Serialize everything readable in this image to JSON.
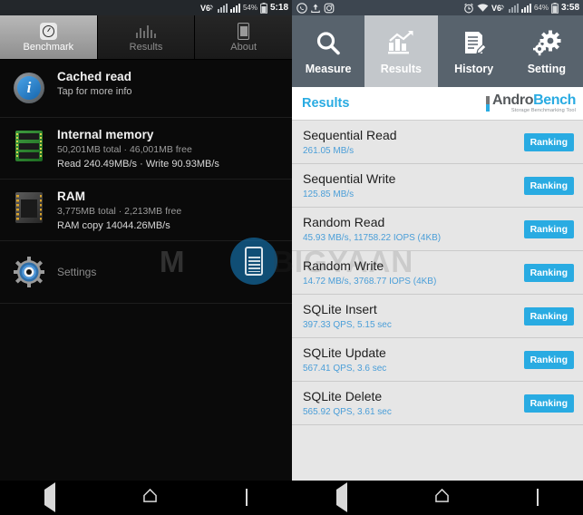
{
  "left_phone": {
    "statusbar": {
      "icons": [
        "volte-icon",
        "signal-roaming-icon",
        "sim-signal-icon",
        "signal-bars-icon"
      ],
      "battery_percent": "54%",
      "battery_icon": "battery-icon",
      "time": "5:18"
    },
    "tabs": [
      {
        "label": "Benchmark",
        "icon": "gauge-icon",
        "selected": true
      },
      {
        "label": "Results",
        "icon": "bar-chart-icon",
        "selected": false
      },
      {
        "label": "About",
        "icon": "phone-icon",
        "selected": false
      }
    ],
    "rows": [
      {
        "icon": "info-icon",
        "title": "Cached read",
        "sub": "Tap for more info",
        "sub2": ""
      },
      {
        "icon": "memory-chip-icon",
        "title": "Internal memory",
        "sub": "50,201MB total · 46,001MB free",
        "sub2": "Read 240.49MB/s · Write 90.93MB/s"
      },
      {
        "icon": "ram-chip-icon",
        "title": "RAM",
        "sub": "3,775MB total · 2,213MB free",
        "sub2": "RAM copy 14044.26MB/s"
      }
    ],
    "settings": {
      "icon": "gear-icon",
      "label": "Settings"
    }
  },
  "right_phone": {
    "statusbar": {
      "left_icons": [
        "whatsapp-icon",
        "upload-icon",
        "instagram-icon"
      ],
      "right_icons": [
        "alarm-icon",
        "wifi-icon",
        "volte-icon",
        "signal-roaming-icon",
        "sim-signal-icon",
        "signal-bars-icon"
      ],
      "battery_percent": "64%",
      "battery_icon": "battery-icon",
      "time": "3:58"
    },
    "tabs": [
      {
        "label": "Measure",
        "icon": "magnifier-icon",
        "selected": false
      },
      {
        "label": "Results",
        "icon": "chart-growth-icon",
        "selected": true
      },
      {
        "label": "History",
        "icon": "document-pen-icon",
        "selected": false
      },
      {
        "label": "Setting",
        "icon": "gears-icon",
        "selected": false
      }
    ],
    "header": {
      "title": "Results",
      "logo_main_a": "Andro",
      "logo_main_b": "Bench",
      "logo_sub": "Storage Benchmarking Tool"
    },
    "results": [
      {
        "name": "Sequential Read",
        "value": "261.05 MB/s",
        "button": "Ranking"
      },
      {
        "name": "Sequential Write",
        "value": "125.85 MB/s",
        "button": "Ranking"
      },
      {
        "name": "Random Read",
        "value": "45.93 MB/s, 11758.22 IOPS (4KB)",
        "button": "Ranking"
      },
      {
        "name": "Random Write",
        "value": "14.72 MB/s, 3768.77 IOPS (4KB)",
        "button": "Ranking"
      },
      {
        "name": "SQLite Insert",
        "value": "397.33 QPS, 5.15 sec",
        "button": "Ranking"
      },
      {
        "name": "SQLite Update",
        "value": "567.41 QPS, 3.6 sec",
        "button": "Ranking"
      },
      {
        "name": "SQLite Delete",
        "value": "565.92 QPS, 3.61 sec",
        "button": "Ranking"
      }
    ]
  },
  "watermark": {
    "text_a": "M",
    "text_b": "BIGYAAN",
    "logo": "phone-badge-icon"
  },
  "navbar": {
    "back": "back-icon",
    "home": "home-icon",
    "recents": "recents-icon"
  },
  "colors": {
    "accent_blue": "#29abe2",
    "right_header": "#58636d",
    "selected_tab": "#c3c7cb",
    "list_bg": "#e6e6e6",
    "left_bg": "#0a0a0a"
  }
}
